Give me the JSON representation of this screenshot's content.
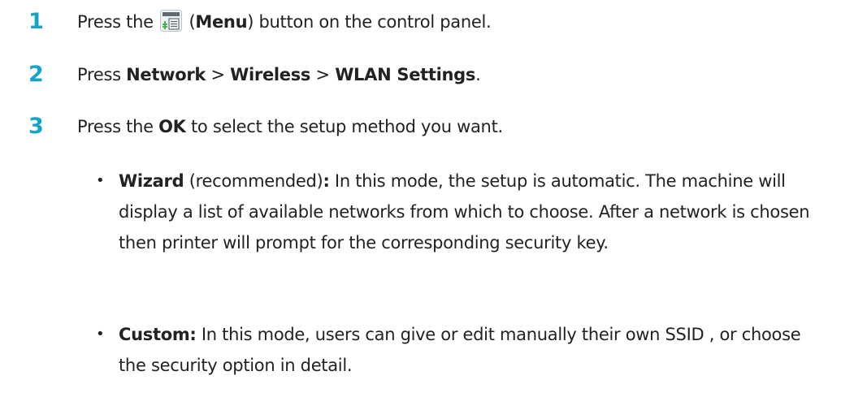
{
  "steps": [
    {
      "number": "1",
      "before": "Press the ",
      "icon": "menu-icon",
      "paren_open": " (",
      "bold": "Menu",
      "after": ") button on the control panel."
    },
    {
      "number": "2",
      "before": "Press ",
      "item1": "Network",
      "sep1": " > ",
      "item2": "Wireless",
      "sep2": " > ",
      "item3": "WLAN Settings",
      "after": "."
    },
    {
      "number": "3",
      "before": "Press the ",
      "bold": "OK",
      "after": " to select the setup method you want."
    }
  ],
  "bullets": [
    {
      "marker": "•",
      "bold": "Wizard",
      "mid": " (recommended)",
      "colon": ":",
      "text": " In this mode, the setup is automatic. The machine will display a list of available networks from which to choose. After a network is chosen then printer will prompt for the corresponding security key."
    },
    {
      "marker": "•",
      "bold": "Custom:",
      "text": " In this mode, users can give or edit manually their own SSID , or choose the security option in detail."
    }
  ],
  "colors": {
    "step_number": "#14a4c8",
    "body_text": "#222222"
  }
}
